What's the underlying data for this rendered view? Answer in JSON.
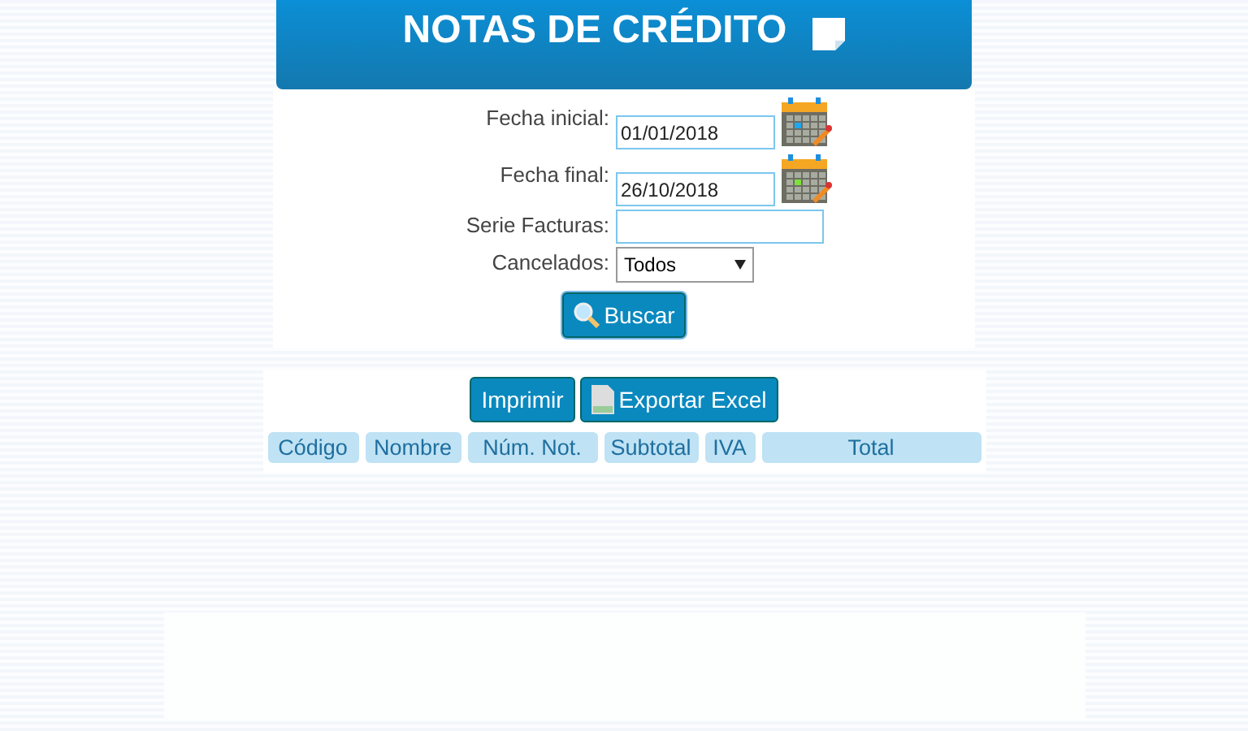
{
  "header": {
    "title": "NOTAS DE CRÉDITO"
  },
  "form": {
    "fields": [
      {
        "kind": "date",
        "label": "Fecha inicial:",
        "value": "01/01/2018"
      },
      {
        "kind": "date",
        "label": "Fecha final:",
        "value": "26/10/2018"
      },
      {
        "kind": "text",
        "label": "Serie Facturas:"
      },
      {
        "kind": "select",
        "label": "Cancelados:",
        "value": "Todos"
      }
    ],
    "search_button": "Buscar"
  },
  "actions": {
    "print_button": "Imprimir",
    "export_button": "Exportar Excel"
  },
  "table": {
    "columns": [
      "Código",
      "Nombre",
      "Núm. Not.",
      "Subtotal",
      "IVA",
      "Total"
    ]
  }
}
